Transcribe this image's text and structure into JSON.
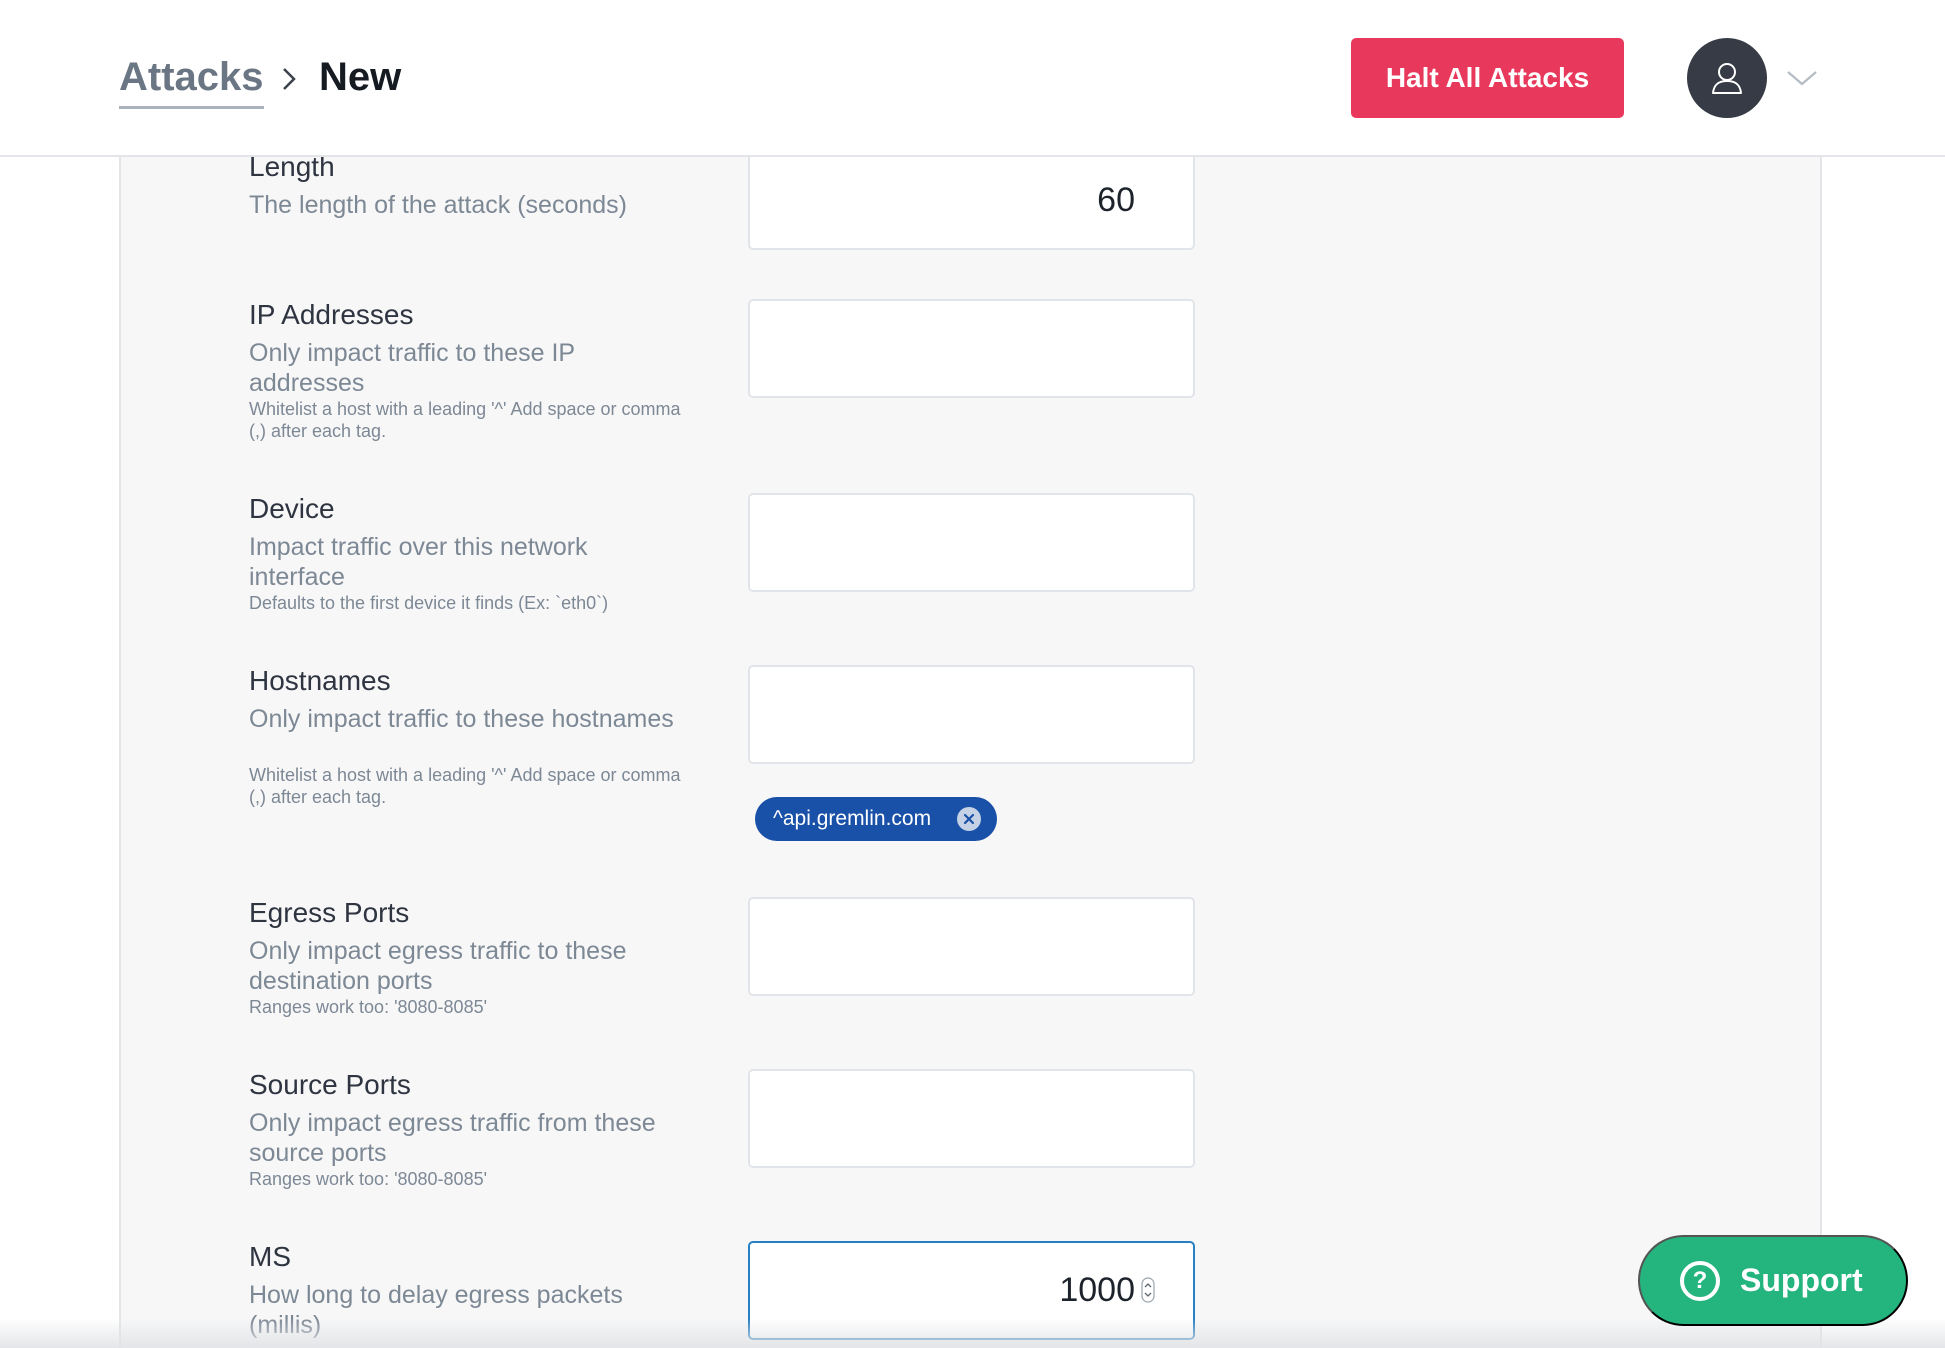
{
  "header": {
    "breadcrumb_root": "Attacks",
    "breadcrumb_current": "New",
    "halt_label": "Halt All Attacks"
  },
  "fields": [
    {
      "label": "Length",
      "description": "The length of the attack (seconds)",
      "hint": "",
      "value": "60"
    },
    {
      "label": "IP Addresses",
      "description": "Only impact traffic to these IP addresses",
      "hint": "Whitelist a host with a leading '^' Add space or comma (,) after each tag.",
      "value": ""
    },
    {
      "label": "Device",
      "description": "Impact traffic over this network interface",
      "hint": "Defaults to the first device it finds (Ex: `eth0`)",
      "value": ""
    },
    {
      "label": "Hostnames",
      "description": "Only impact traffic to these hostnames",
      "hint": "Whitelist a host with a leading '^' Add space or comma (,) after each tag.",
      "value": "",
      "tags": [
        "^api.gremlin.com"
      ]
    },
    {
      "label": "Egress Ports",
      "description": "Only impact egress traffic to these destination ports",
      "hint": "Ranges work too: '8080-8085'",
      "value": ""
    },
    {
      "label": "Source Ports",
      "description": "Only impact egress traffic from these source ports",
      "hint": "Ranges work too: '8080-8085'",
      "value": ""
    },
    {
      "label": "MS",
      "description": "How long to delay egress packets (millis)",
      "hint": "",
      "value": "1000"
    }
  ],
  "support": {
    "label": "Support",
    "icon_glyph": "?"
  },
  "icons": {
    "breadcrumb_separator": "chevron-right-icon",
    "avatar": "user-icon",
    "menu_caret": "chevron-down-icon",
    "tag_remove": "close-icon",
    "support": "question-icon"
  },
  "colors": {
    "halt": "#e8395c",
    "tag": "#1950a8",
    "support": "#24b47e",
    "focus": "#2680c2",
    "avatar": "#363b45"
  }
}
